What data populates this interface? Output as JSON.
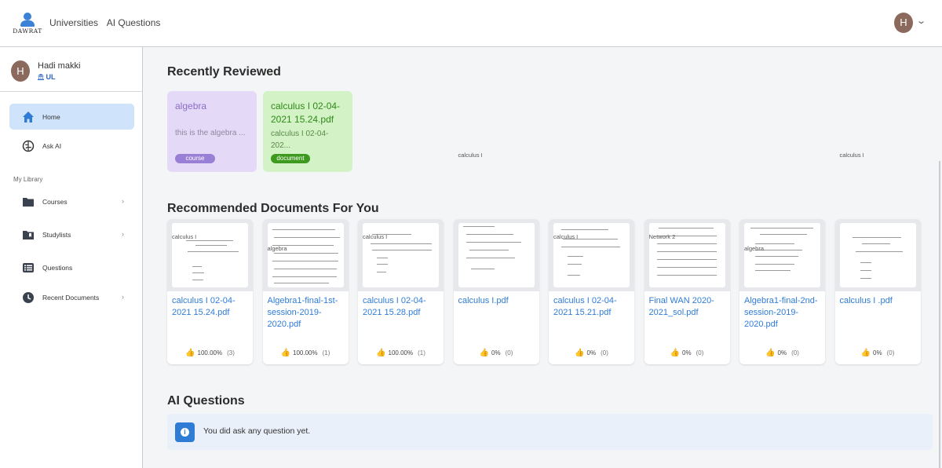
{
  "app": {
    "logo_text": "DAWRAT",
    "avatar_initial": "H"
  },
  "nav": {
    "universities": "Universities",
    "ai_questions": "AI Questions"
  },
  "user": {
    "initial": "H",
    "name": "Hadi makki",
    "university": "UL"
  },
  "sidebar": {
    "items": [
      {
        "label": "Home",
        "icon": "home-icon"
      },
      {
        "label": "Ask AI",
        "icon": "brain-icon"
      }
    ],
    "library_heading": "My Library",
    "library": [
      {
        "label": "Courses",
        "icon": "folder-icon"
      },
      {
        "label": "Studylists",
        "icon": "bookmark-folder-icon"
      },
      {
        "label": "Questions",
        "icon": "list-icon"
      },
      {
        "label": "Recent Documents",
        "icon": "clock-icon"
      }
    ]
  },
  "recently_reviewed": {
    "heading": "Recently Reviewed",
    "cards": [
      {
        "title": "algebra",
        "desc": "this is the algebra ...",
        "tag": "course",
        "color": "#e4daf7",
        "tag_color": "#9a7fd6"
      },
      {
        "title": "calculus I 02-04-2021 15.24.pdf",
        "desc": "calculus I 02-04-202...",
        "tag": "document",
        "color": "#d3f2c5",
        "tag_color": "#3d9a1f"
      }
    ]
  },
  "recommended": {
    "heading": "Recommended Documents For You",
    "docs": [
      {
        "title": "calculus I 02-04-2021 15.24.pdf",
        "course": "calculus I",
        "rating": "100.00%",
        "count": "(3)"
      },
      {
        "title": "Algebra1-final-1st-session-2019-2020.pdf",
        "course": "algebra",
        "rating": "100.00%",
        "count": "(1)"
      },
      {
        "title": "calculus I 02-04-2021 15.28.pdf",
        "course": "calculus I",
        "rating": "100.00%",
        "count": "(1)"
      },
      {
        "title": "calculus I.pdf",
        "course": "calculus I",
        "rating": "0%",
        "count": "(0)"
      },
      {
        "title": "calculus I 02-04-2021 15.21.pdf",
        "course": "calculus I",
        "rating": "0%",
        "count": "(0)"
      },
      {
        "title": "Final WAN 2020-2021_sol.pdf",
        "course": "Network 2",
        "rating": "0%",
        "count": "(0)"
      },
      {
        "title": "Algebra1-final-2nd-session-2019-2020.pdf",
        "course": "algebra",
        "rating": "0%",
        "count": "(0)"
      },
      {
        "title": "calculus I .pdf",
        "course": "calculus I",
        "rating": "0%",
        "count": "(0)"
      }
    ]
  },
  "ai_questions": {
    "heading": "AI Questions",
    "empty_message": "You did ask any question yet."
  }
}
